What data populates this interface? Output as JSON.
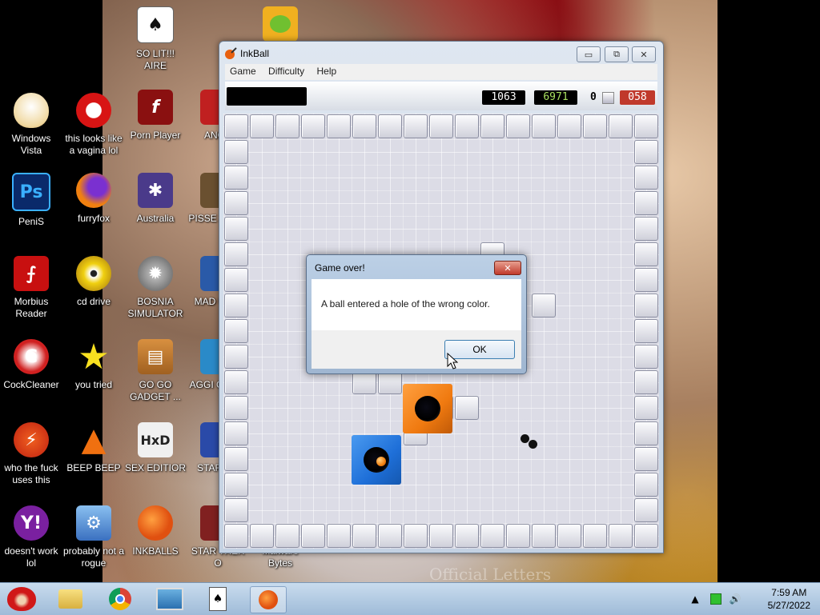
{
  "desktop_icons": [
    {
      "label": "Windows Vista",
      "color": "#f5e4b8"
    },
    {
      "label": "this looks like a vagina lol",
      "color": "#d81414"
    },
    {
      "label": "Porn Player",
      "color": "#8a1010"
    },
    {
      "label": "ANGE",
      "color": "#c02020"
    },
    {
      "label": "PeniS",
      "color": "#0a3a8a"
    },
    {
      "label": "furryfox",
      "color": "#e86a10"
    },
    {
      "label": "Australia",
      "color": "#4a3a8a"
    },
    {
      "label": "PISSE AVIAN",
      "color": "#6a5030"
    },
    {
      "label": "Morbius Reader",
      "color": "#c01010"
    },
    {
      "label": "cd drive",
      "color": "#d8b010"
    },
    {
      "label": "BOSNIA SIMULATOR",
      "color": "#707070"
    },
    {
      "label": "MAD UNIV",
      "color": "#2a5aa8"
    },
    {
      "label": "CockCleaner",
      "color": "#c82020"
    },
    {
      "label": "you tried",
      "color": "#f0d010"
    },
    {
      "label": "GO GO GADGET ...",
      "color": "#b87020"
    },
    {
      "label": "AGGI CHICK",
      "color": "#2a8ac8"
    },
    {
      "label": "who the fuck uses this",
      "color": "#f04010"
    },
    {
      "label": "BEEP BEEP",
      "color": "#f07010"
    },
    {
      "label": "SEX EDITIOR",
      "color": "#5a8a30"
    },
    {
      "label": "STAR GA",
      "color": "#2a4aa8"
    },
    {
      "label": "doesn't work lol",
      "color": "#7a20a0"
    },
    {
      "label": "probably not a rogue",
      "color": "#4a8ad8"
    },
    {
      "label": "INKBALLS",
      "color": "#e86010"
    },
    {
      "label": "STAR TREK O",
      "color": "#802020"
    },
    {
      "label": "SO LIT!!! AIRE",
      "color": "#e0e0e0"
    },
    {
      "label": "Malware Bytes",
      "color": "#a0d020"
    }
  ],
  "window": {
    "title": "InkBall",
    "minimize_label": "▭",
    "restore_label": "⧉",
    "close_label": "✕",
    "menu": [
      "Game",
      "Difficulty",
      "Help"
    ],
    "scores": {
      "score": "1063",
      "high_score": "6971",
      "balls": "0",
      "time": "058"
    },
    "score_colors": {
      "score": "#ffffff",
      "high_score": "#a8e060",
      "time": "#ffffff",
      "time_bg": "#c0392b"
    }
  },
  "board": {
    "hole_colors": {
      "blue": "#1e6fd8",
      "orange": "#f07a10"
    }
  },
  "dialog": {
    "title": "Game over!",
    "close_label": "✕",
    "message": "A ball entered a hole of the wrong color.",
    "ok_label": "OK"
  },
  "wallpaper_caption": "Official Letters",
  "taskbar": {
    "time": "7:59 AM",
    "date": "5/27/2022"
  }
}
